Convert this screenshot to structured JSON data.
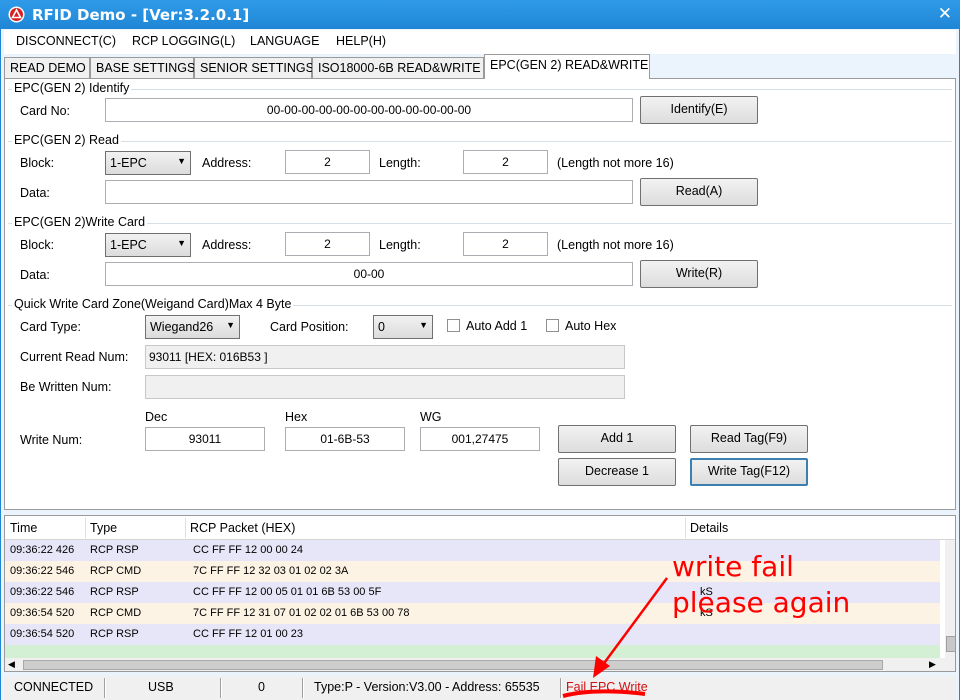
{
  "window": {
    "title": "RFID Demo - [Ver:3.2.0.1]",
    "close": "✕"
  },
  "menu": [
    "DISCONNECT(C)",
    "RCP LOGGING(L)",
    "LANGUAGE",
    "HELP(H)"
  ],
  "tabs": [
    "READ DEMO",
    "BASE SETTINGS",
    "SENIOR SETTINGS",
    "ISO18000-6B READ&WRITE",
    "EPC(GEN 2) READ&WRITE"
  ],
  "identify": {
    "title": "EPC(GEN 2) Identify",
    "card_no_label": "Card No:",
    "card_no": "00-00-00-00-00-00-00-00-00-00-00-00",
    "button": "Identify(E)"
  },
  "read": {
    "title": "EPC(GEN 2) Read",
    "block_label": "Block:",
    "block": "1-EPC",
    "address_label": "Address:",
    "address": "2",
    "length_label": "Length:",
    "length": "2",
    "note": "(Length not more 16)",
    "data_label": "Data:",
    "data": "",
    "button": "Read(A)"
  },
  "write": {
    "title": "EPC(GEN 2)Write Card",
    "block_label": "Block:",
    "block": "1-EPC",
    "address_label": "Address:",
    "address": "2",
    "length_label": "Length:",
    "length": "2",
    "note": "(Length not more 16)",
    "data_label": "Data:",
    "data": "00-00",
    "button": "Write(R)"
  },
  "quick": {
    "title": "Quick Write Card Zone(Weigand Card)Max 4 Byte",
    "card_type_label": "Card Type:",
    "card_type": "Wiegand26",
    "card_position_label": "Card Position:",
    "card_position": "0",
    "auto_add_label": "Auto Add 1",
    "auto_hex_label": "Auto Hex",
    "current_read_label": "Current Read Num:",
    "current_read": "93011 [HEX: 016B53 ]",
    "be_written_label": "Be Written Num:",
    "be_written": "",
    "dec_label": "Dec",
    "hex_label": "Hex",
    "wg_label": "WG",
    "write_num_label": "Write Num:",
    "dec": "93011",
    "hex": "01-6B-53",
    "wg": "001,27475",
    "add_button": "Add 1",
    "decrease_button": "Decrease 1",
    "read_tag_button": "Read Tag(F9)",
    "write_tag_button": "Write Tag(F12)"
  },
  "log": {
    "headers": [
      "Time",
      "Type",
      "RCP Packet (HEX)",
      "Details"
    ],
    "rows": [
      {
        "time": "09:36:22 426",
        "type": "RCP RSP",
        "packet": "CC FF FF 12 00 00 24",
        "details": ""
      },
      {
        "time": "09:36:22 546",
        "type": "RCP CMD",
        "packet": "7C FF FF 12 32 03 01 02 02 3A",
        "details": ""
      },
      {
        "time": "09:36:22 546",
        "type": "RCP RSP",
        "packet": "CC FF FF 12 00 05 01 01 6B 53 00 5F",
        "details": "kS"
      },
      {
        "time": "09:36:54 520",
        "type": "RCP CMD",
        "packet": "7C FF FF 12 31 07 01 02 02 01 6B 53 00 78",
        "details": "kS"
      },
      {
        "time": "09:36:54 520",
        "type": "RCP RSP",
        "packet": "CC FF FF 12 01 00 23",
        "details": ""
      }
    ]
  },
  "status": {
    "connection": "CONNECTED",
    "interface": "USB",
    "count": "0",
    "info": "Type:P - Version:V3.00 - Address: 65535",
    "message": "Fail EPC Write"
  },
  "annotation": {
    "line1": "write fail",
    "line2": "please again"
  },
  "colors": {
    "title_bar": "#1f86d6",
    "row_blue": "#e6e6f8",
    "row_cream": "#fdf3e4",
    "annotation": "#ff0000"
  }
}
